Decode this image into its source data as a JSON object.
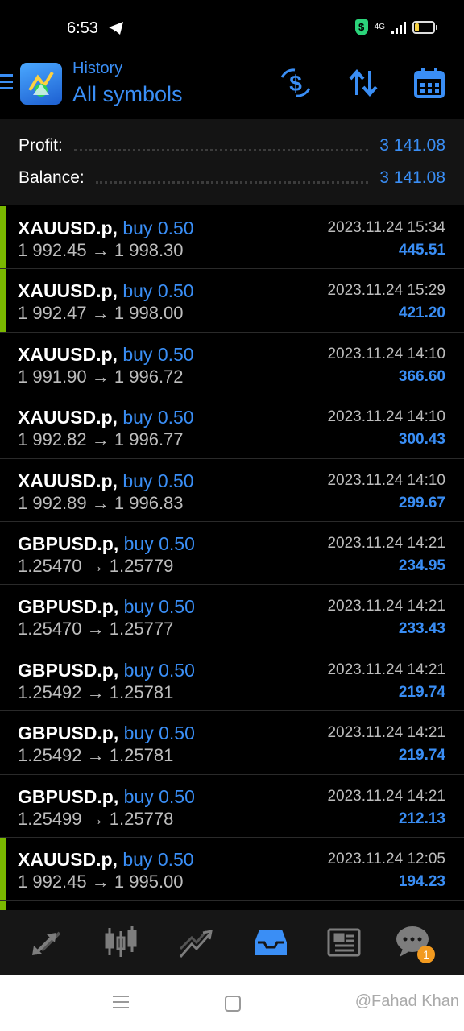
{
  "status_bar": {
    "time": "6:53",
    "network": "4G",
    "shield_glyph": "$",
    "icons": [
      "telegram-icon",
      "shield-icon",
      "signal-icon",
      "battery-icon"
    ]
  },
  "header": {
    "subtitle": "History",
    "title": "All symbols",
    "icons": [
      "menu-icon",
      "metatrader-logo",
      "deposit-icon",
      "sort-icon",
      "calendar-icon"
    ]
  },
  "summary": {
    "profit_label": "Profit:",
    "profit_value": "3 141.08",
    "balance_label": "Balance:",
    "balance_value": "3 141.08"
  },
  "trades": [
    {
      "symbol": "XAUUSD.p,",
      "direction": "buy 0.50",
      "open": "1 992.45",
      "close": "1 998.30",
      "time": "2023.11.24 15:34",
      "profit": "445.51",
      "marked": true
    },
    {
      "symbol": "XAUUSD.p,",
      "direction": "buy 0.50",
      "open": "1 992.47",
      "close": "1 998.00",
      "time": "2023.11.24 15:29",
      "profit": "421.20",
      "marked": true
    },
    {
      "symbol": "XAUUSD.p,",
      "direction": "buy 0.50",
      "open": "1 991.90",
      "close": "1 996.72",
      "time": "2023.11.24 14:10",
      "profit": "366.60",
      "marked": false
    },
    {
      "symbol": "XAUUSD.p,",
      "direction": "buy 0.50",
      "open": "1 992.82",
      "close": "1 996.77",
      "time": "2023.11.24 14:10",
      "profit": "300.43",
      "marked": false
    },
    {
      "symbol": "XAUUSD.p,",
      "direction": "buy 0.50",
      "open": "1 992.89",
      "close": "1 996.83",
      "time": "2023.11.24 14:10",
      "profit": "299.67",
      "marked": false
    },
    {
      "symbol": "GBPUSD.p,",
      "direction": "buy 0.50",
      "open": "1.25470",
      "close": "1.25779",
      "time": "2023.11.24 14:21",
      "profit": "234.95",
      "marked": false
    },
    {
      "symbol": "GBPUSD.p,",
      "direction": "buy 0.50",
      "open": "1.25470",
      "close": "1.25777",
      "time": "2023.11.24 14:21",
      "profit": "233.43",
      "marked": false
    },
    {
      "symbol": "GBPUSD.p,",
      "direction": "buy 0.50",
      "open": "1.25492",
      "close": "1.25781",
      "time": "2023.11.24 14:21",
      "profit": "219.74",
      "marked": false
    },
    {
      "symbol": "GBPUSD.p,",
      "direction": "buy 0.50",
      "open": "1.25492",
      "close": "1.25781",
      "time": "2023.11.24 14:21",
      "profit": "219.74",
      "marked": false
    },
    {
      "symbol": "GBPUSD.p,",
      "direction": "buy 0.50",
      "open": "1.25499",
      "close": "1.25778",
      "time": "2023.11.24 14:21",
      "profit": "212.13",
      "marked": false
    },
    {
      "symbol": "XAUUSD.p,",
      "direction": "buy 0.50",
      "open": "1 992.45",
      "close": "1 995.00",
      "time": "2023.11.24 12:05",
      "profit": "194.23",
      "marked": true
    }
  ],
  "arrow": "→",
  "bottom_nav": {
    "items": [
      "quotes-icon",
      "chart-icon",
      "trade-icon",
      "history-icon",
      "news-icon",
      "chat-icon"
    ],
    "active": "history-icon",
    "chat_badge": "1"
  },
  "system_nav": {
    "watermark": "@Fahad Khan"
  },
  "colors": {
    "accent": "#3a8ef5",
    "marker": "#7ab800",
    "badge": "#f29a1f",
    "background": "#000000",
    "summary_bg": "#141414"
  }
}
